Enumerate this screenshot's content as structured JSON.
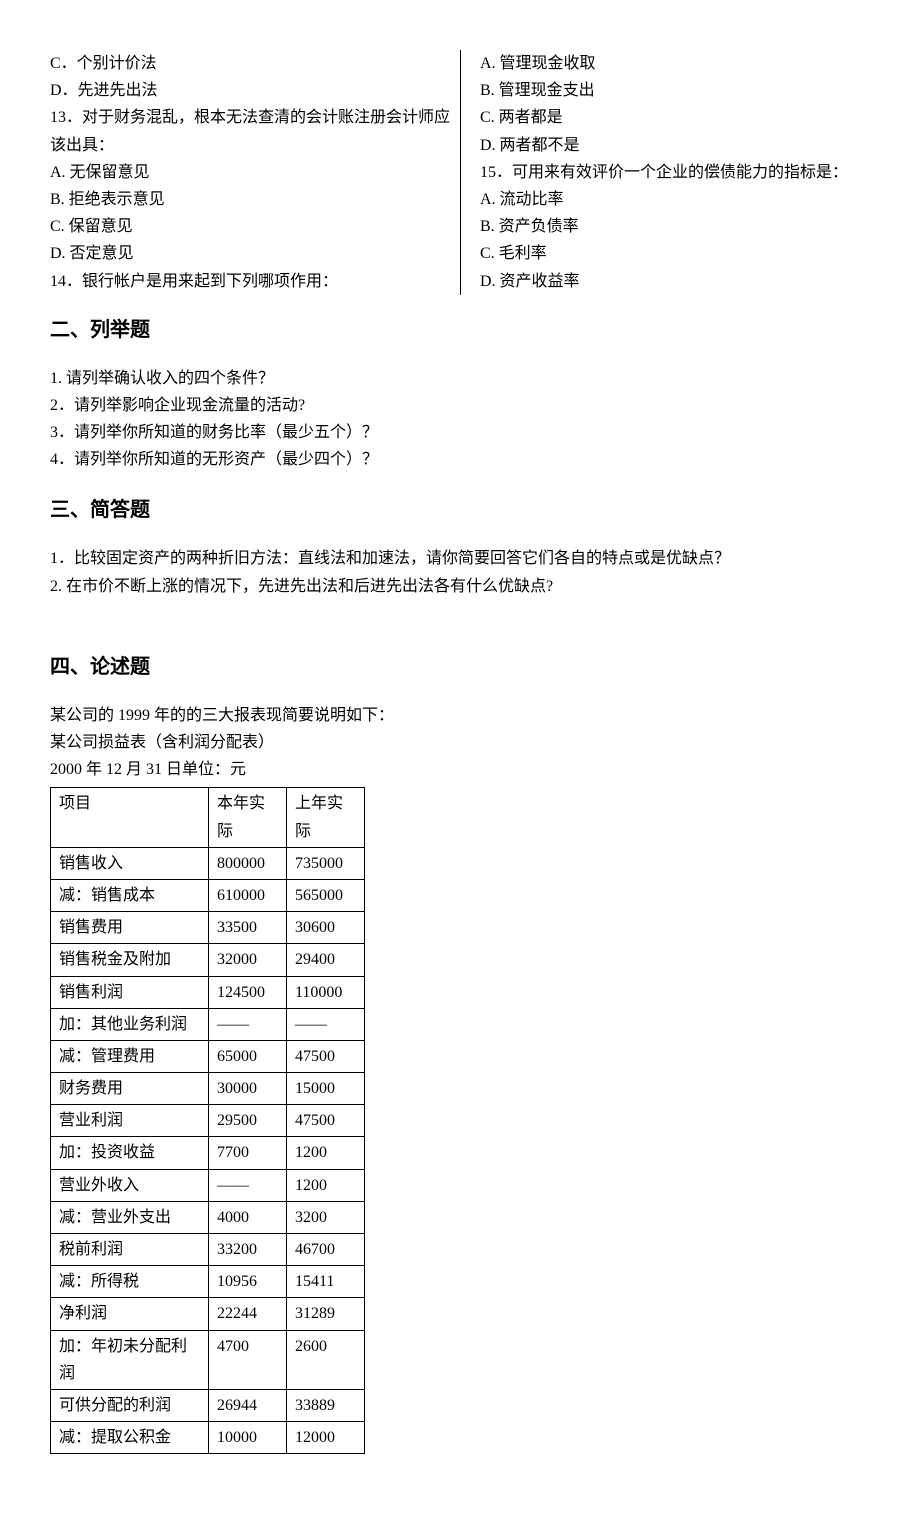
{
  "mc": {
    "left": [
      "C．个别计价法",
      "D．先进先出法",
      "13．对于财务混乱，根本无法查清的会计账注册会计师应该出具：",
      "A. 无保留意见",
      "B. 拒绝表示意见",
      "C. 保留意见",
      "D. 否定意见",
      "14．银行帐户是用来起到下列哪项作用："
    ],
    "right": [
      "A. 管理现金收取",
      "B. 管理现金支出",
      "C. 两者都是",
      "D. 两者都不是",
      "15．可用来有效评价一个企业的偿债能力的指标是：",
      "A. 流动比率",
      "B. 资产负债率",
      "C. 毛利率",
      "D. 资产收益率"
    ]
  },
  "section2": {
    "title": "二、列举题",
    "items": [
      "1. 请列举确认收入的四个条件？",
      "2．请列举影响企业现金流量的活动?",
      "3．请列举你所知道的财务比率（最少五个）？",
      "4．请列举你所知道的无形资产（最少四个）？"
    ]
  },
  "section3": {
    "title": "三、简答题",
    "items": [
      "1．比较固定资产的两种折旧方法：直线法和加速法，请你简要回答它们各自的特点或是优缺点？",
      "2. 在市价不断上涨的情况下，先进先出法和后进先出法各有什么优缺点?"
    ]
  },
  "section4": {
    "title": "四、论述题",
    "intro": [
      "某公司的 1999 年的的三大报表现简要说明如下：",
      "某公司损益表（含利润分配表）",
      "2000 年 12 月 31 日单位：元"
    ],
    "table": {
      "header": [
        "项目",
        "本年实际",
        "上年实际"
      ],
      "rows": [
        [
          "销售收入",
          "800000",
          "735000"
        ],
        [
          "减：销售成本",
          "610000",
          "565000"
        ],
        [
          "销售费用",
          "33500",
          "30600"
        ],
        [
          "销售税金及附加",
          "32000",
          "29400"
        ],
        [
          "销售利润",
          "124500",
          "110000"
        ],
        [
          "加：其他业务利润",
          "——",
          "——"
        ],
        [
          "减：管理费用",
          "65000",
          "47500"
        ],
        [
          "财务费用",
          "30000",
          "15000"
        ],
        [
          "营业利润",
          "29500",
          "47500"
        ],
        [
          "加：投资收益",
          "7700",
          "1200"
        ],
        [
          "营业外收入",
          "——",
          "1200"
        ],
        [
          "减：营业外支出",
          "4000",
          "3200"
        ],
        [
          "税前利润",
          "33200",
          "46700"
        ],
        [
          "减：所得税",
          "10956",
          "15411"
        ],
        [
          "净利润",
          "22244",
          "31289"
        ],
        [
          "加：年初未分配利润",
          "4700",
          "2600"
        ],
        [
          "可供分配的利润",
          "26944",
          "33889"
        ],
        [
          "减：提取公积金",
          "10000",
          "12000"
        ]
      ]
    }
  }
}
